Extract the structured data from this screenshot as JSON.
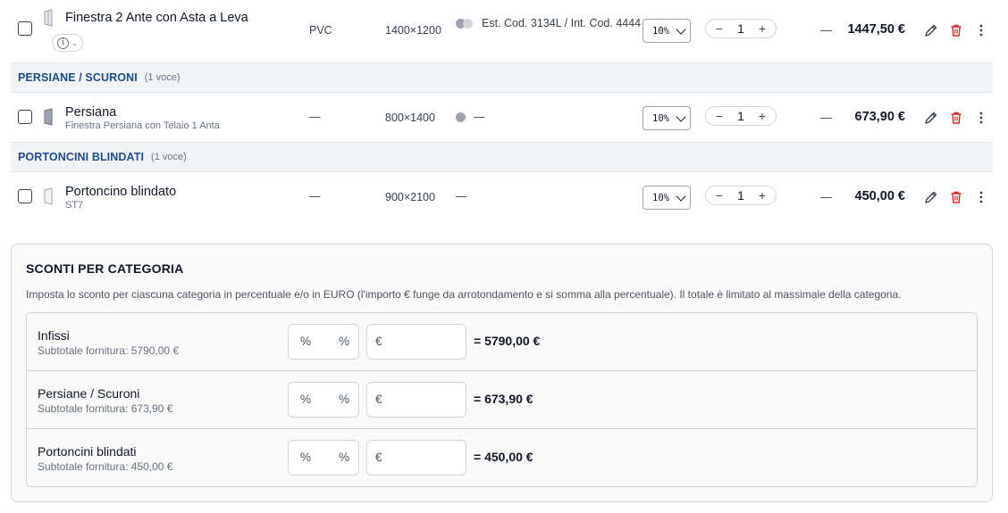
{
  "rows": [
    {
      "name": "Finestra 2 Ante con Asta a Leva",
      "material": "PVC",
      "dimensions": "1400×1200",
      "color_text": "Est. Cod. 3134L / Int. Cod. 4444",
      "discount": "10%",
      "qty": "1",
      "dash": "—",
      "price": "1447,50 €"
    },
    {
      "name": "Persiana",
      "subtitle": "Finestra Persiana con Telaio 1 Anta",
      "material": "—",
      "dimensions": "800×1400",
      "color_text": "—",
      "discount": "10%",
      "qty": "1",
      "dash": "—",
      "price": "673,90 €"
    },
    {
      "name": "Portoncino blindato",
      "subtitle": "ST7",
      "material": "—",
      "dimensions": "900×2100",
      "color_text": "—",
      "discount": "10%",
      "qty": "1",
      "dash": "—",
      "price": "450,00 €"
    }
  ],
  "groups": [
    {
      "name": "PERSIANE / SCURONI",
      "count": "(1 voce)"
    },
    {
      "name": "PORTONCINI BLINDATI",
      "count": "(1 voce)"
    }
  ],
  "stepper": {
    "minus": "−",
    "plus": "+"
  },
  "colors": {
    "accent_blue": "#1e4d8c",
    "danger_red": "#dc2626",
    "swatch_grey": "#9ca3af"
  },
  "icons": {
    "info": "info-icon",
    "edit": "pencil-icon",
    "delete": "trash-icon",
    "more": "more-vertical-icon"
  },
  "panel": {
    "title": "SCONTI PER CATEGORIA",
    "description": "Imposta lo sconto per ciascuna categoria in percentuale e/o in EURO (l'importo € funge da arrotondamento e si somma alla percentuale). Il totale è limitato al massimale della categoria.",
    "categories": [
      {
        "name": "Infissi",
        "subtotal": "Subtotale fornitura: 5790,00 €",
        "pct_placeholder": "%",
        "pct_suffix": "%",
        "eur_placeholder": "€",
        "total": "= 5790,00 €"
      },
      {
        "name": "Persiane / Scuroni",
        "subtotal": "Subtotale fornitura: 673,90 €",
        "pct_placeholder": "%",
        "pct_suffix": "%",
        "eur_placeholder": "€",
        "total": "= 673,90 €"
      },
      {
        "name": "Portoncini blindati",
        "subtotal": "Subtotale fornitura: 450,00 €",
        "pct_placeholder": "%",
        "pct_suffix": "%",
        "eur_placeholder": "€",
        "total": "= 450,00 €"
      }
    ]
  }
}
